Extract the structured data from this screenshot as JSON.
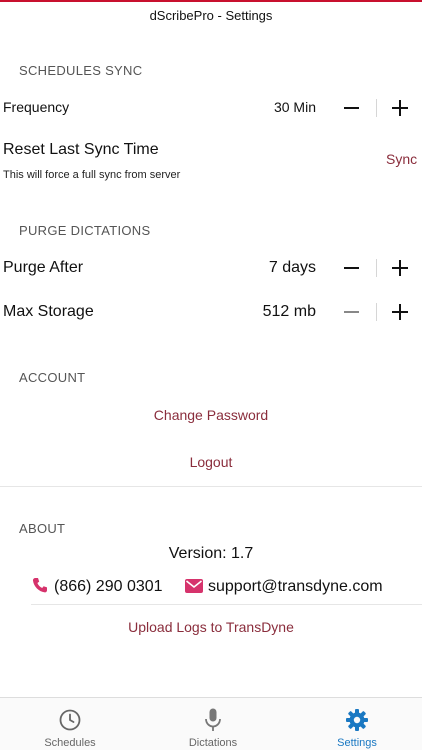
{
  "app": {
    "title": "dScribePro - Settings"
  },
  "schedules_sync": {
    "header": "SCHEDULES SYNC",
    "frequency": {
      "label": "Frequency",
      "value": "30 Min"
    },
    "reset": {
      "label": "Reset Last Sync Time",
      "subtitle": "This will force a full sync from server",
      "action": "Sync"
    }
  },
  "purge_dictations": {
    "header": "PURGE DICTATIONS",
    "purge_after": {
      "label": "Purge After",
      "value": "7 days"
    },
    "max_storage": {
      "label": "Max Storage",
      "value": "512 mb"
    }
  },
  "account": {
    "header": "ACCOUNT",
    "change_password": "Change Password",
    "logout": "Logout"
  },
  "about": {
    "header": "ABOUT",
    "version": "Version: 1.7",
    "phone": "(866) 290 0301",
    "email": "support@transdyne.com",
    "upload_logs": "Upload Logs to TransDyne"
  },
  "tabbar": {
    "tabs": [
      {
        "label": "Schedules",
        "icon": "clock-icon",
        "active": false
      },
      {
        "label": "Dictations",
        "icon": "microphone-icon",
        "active": false
      },
      {
        "label": "Settings",
        "icon": "gear-icon",
        "active": true
      }
    ]
  },
  "colors": {
    "accent": "#8a2d3c",
    "active_tab": "#1a78c2",
    "top_bar": "#c8102e",
    "contact_icon": "#d6336c"
  }
}
